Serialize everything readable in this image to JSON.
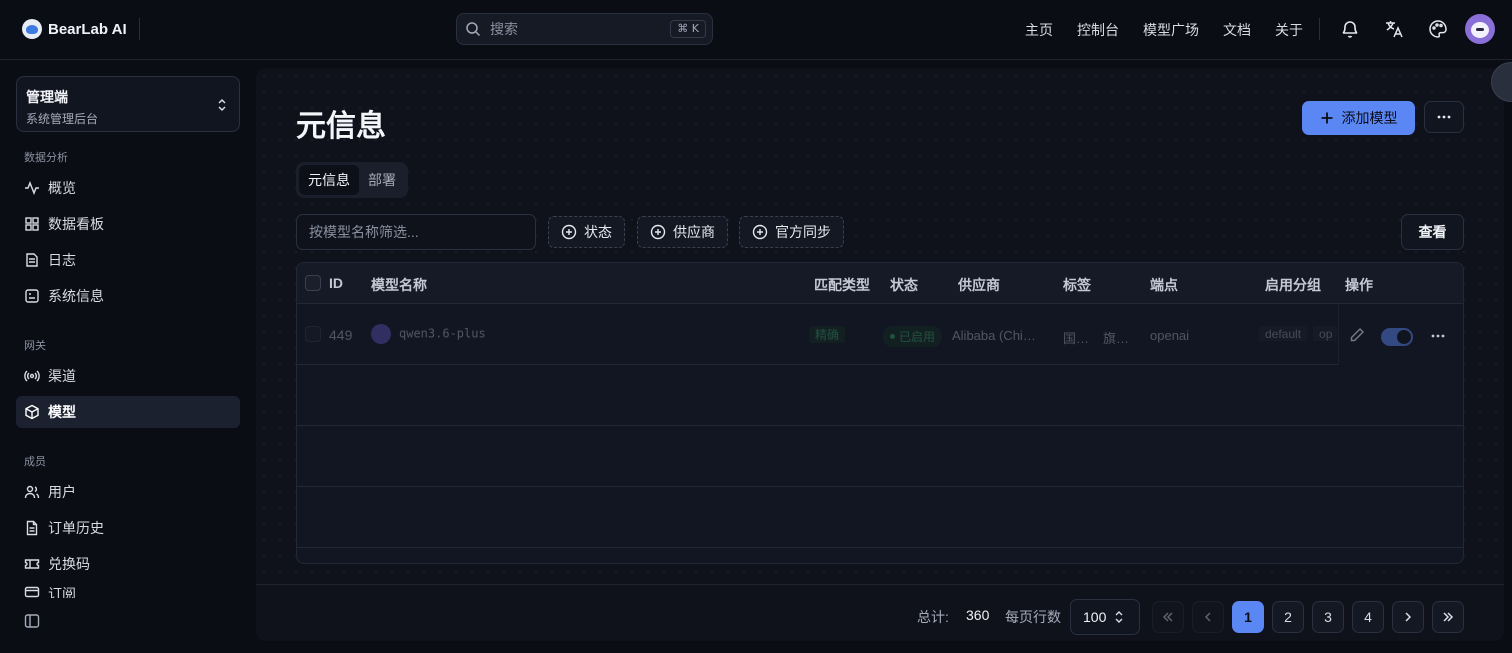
{
  "app": {
    "name": "BearLab AI"
  },
  "search": {
    "placeholder": "搜索",
    "shortcut": "⌘ K"
  },
  "topnav": [
    "主页",
    "控制台",
    "模型广场",
    "文档",
    "关于"
  ],
  "header_icons": [
    "bell-icon",
    "translate-icon",
    "palette-icon",
    "avatar"
  ],
  "switcher": {
    "title": "管理端",
    "subtitle": "系统管理后台"
  },
  "sidebar": {
    "groups": [
      {
        "label": "数据分析",
        "items": [
          {
            "label": "概览",
            "icon": "activity-icon"
          },
          {
            "label": "数据看板",
            "icon": "dashboard-icon"
          },
          {
            "label": "日志",
            "icon": "logs-icon"
          },
          {
            "label": "系统信息",
            "icon": "system-info-icon"
          }
        ]
      },
      {
        "label": "网关",
        "items": [
          {
            "label": "渠道",
            "icon": "broadcast-icon"
          },
          {
            "label": "模型",
            "icon": "cube-icon",
            "active": true
          }
        ]
      },
      {
        "label": "成员",
        "items": [
          {
            "label": "用户",
            "icon": "users-icon"
          },
          {
            "label": "订单历史",
            "icon": "document-icon"
          },
          {
            "label": "兑换码",
            "icon": "ticket-icon"
          },
          {
            "label": "订阅",
            "icon": "card-icon"
          }
        ]
      }
    ]
  },
  "page": {
    "title": "元信息",
    "add_button": "添加模型",
    "more_button": "···",
    "tabs": [
      "元信息",
      "部署"
    ],
    "active_tab": "元信息",
    "filter_placeholder": "按模型名称筛选...",
    "filter_chips": [
      "状态",
      "供应商",
      "官方同步"
    ],
    "view_button": "查看"
  },
  "table": {
    "columns": [
      "ID",
      "模型名称",
      "匹配类型",
      "状态",
      "供应商",
      "标签",
      "端点",
      "启用分组",
      "操作"
    ],
    "rows": [
      {
        "id": "449",
        "name": "qwen3.6-plus",
        "match_type": "精确",
        "status": "已启用",
        "vendor": "Alibaba (Chi…",
        "tags": [
          "国…",
          "旗…"
        ],
        "endpoint": "openai",
        "groups": [
          "default",
          "op"
        ],
        "enabled": true
      }
    ]
  },
  "footer": {
    "total_label": "总计:",
    "total": "360",
    "per_page_label": "每页行数",
    "per_page": "100",
    "pages": [
      "1",
      "2",
      "3",
      "4"
    ],
    "current_page": "1"
  },
  "colors": {
    "accent": "#5b87f5",
    "success": "#3fbf72",
    "background": "#0b0d14"
  }
}
